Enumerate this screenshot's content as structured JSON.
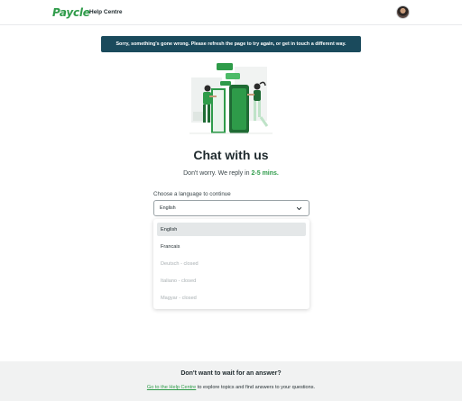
{
  "header": {
    "logo": "Paycle",
    "help_centre": "Help Centre"
  },
  "banner": {
    "message": "Sorry, something's gone wrong. Please refresh the page to try again, or get in touch a different way."
  },
  "main": {
    "title": "Chat with us",
    "subtitle_prefix": "Don't worry. We reply in ",
    "subtitle_highlight": "2-5 mins.",
    "language_label": "Choose a language to continue",
    "selected_language": "English",
    "options": [
      {
        "label": "English",
        "state": "selected"
      },
      {
        "label": "Francais",
        "state": "available"
      },
      {
        "label": "Deutsch - closed",
        "state": "closed"
      },
      {
        "label": "Italiano - closed",
        "state": "closed"
      },
      {
        "label": "Magyar - closed",
        "state": "closed"
      }
    ]
  },
  "footer": {
    "title": "Don't want to wait for an answer?",
    "link_text": "Go to the Help Centre",
    "suffix": " to explore topics and find answers to your questions."
  },
  "colors": {
    "brand_green": "#2e9b49",
    "banner_bg": "#1a4a5c",
    "footer_bg": "#f1f2f2"
  },
  "icons": {
    "dropdown": "chevron-down-icon",
    "avatar": "user-avatar"
  }
}
